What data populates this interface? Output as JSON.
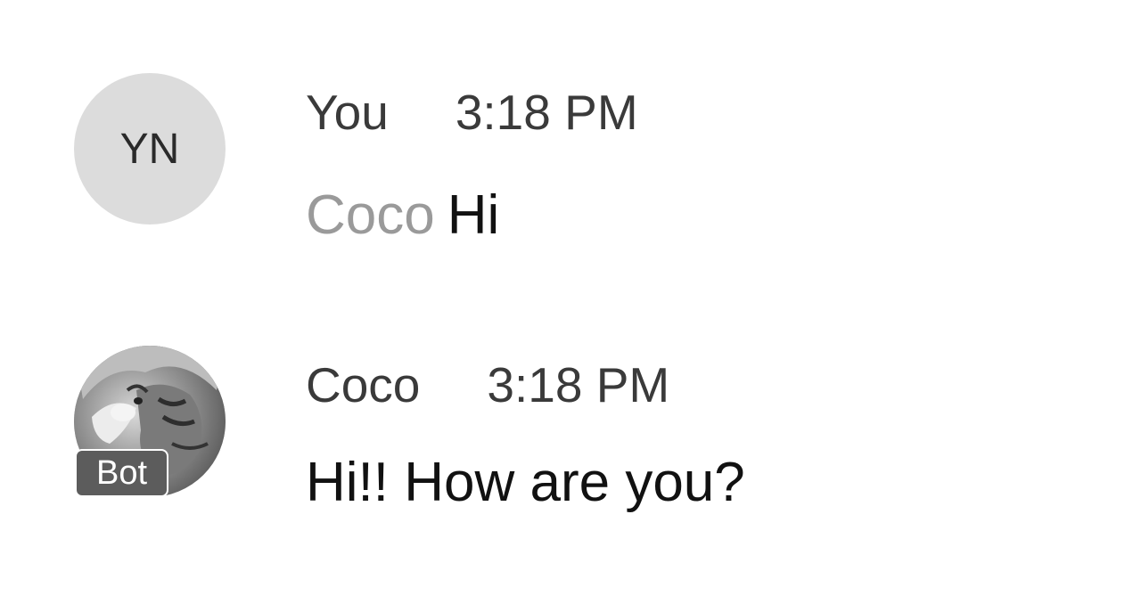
{
  "messages": [
    {
      "avatar": {
        "type": "initials",
        "initials": "YN"
      },
      "sender": "You",
      "time": "3:18 PM",
      "mention": "Coco",
      "text": "Hi"
    },
    {
      "avatar": {
        "type": "photo",
        "description_icon": "cat-photo-avatar",
        "badge": "Bot"
      },
      "sender": "Coco",
      "time": "3:18 PM",
      "text": "Hi!! How are you?"
    }
  ],
  "colors": {
    "background": "#ffffff",
    "initials_avatar_bg": "#dcdcdc",
    "mention_text": "#9a9a9a",
    "badge_bg": "#5c5c5c",
    "body_text": "#111111",
    "meta_text": "#3a3a3a"
  }
}
